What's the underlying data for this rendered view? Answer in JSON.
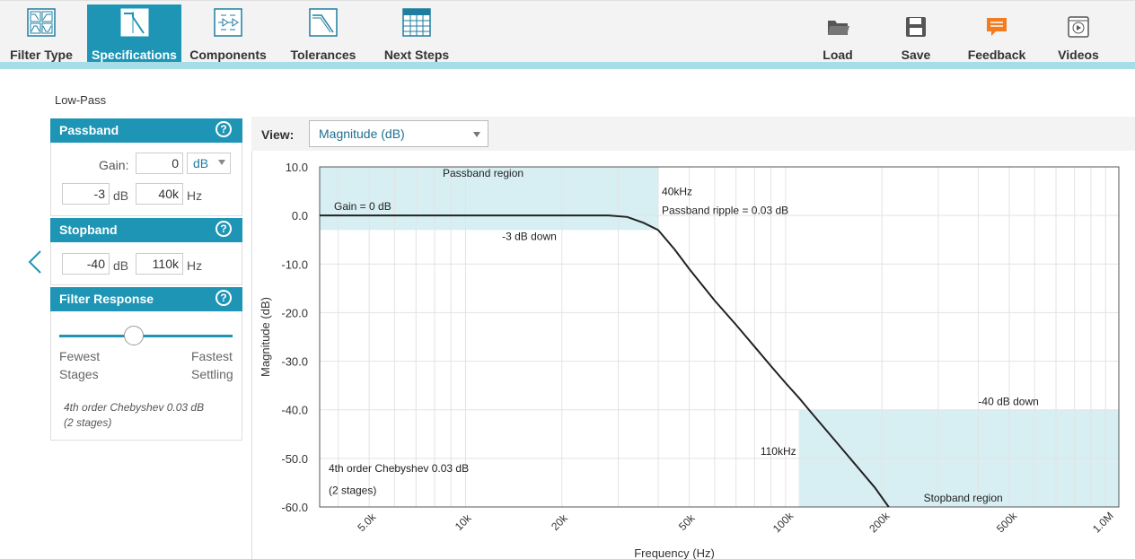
{
  "toolbar": {
    "tabs": [
      {
        "label": "Filter Type",
        "icon": "filter-type-icon"
      },
      {
        "label": "Specifications",
        "icon": "specifications-icon",
        "active": true
      },
      {
        "label": "Components",
        "icon": "components-icon"
      },
      {
        "label": "Tolerances",
        "icon": "tolerances-icon"
      },
      {
        "label": "Next Steps",
        "icon": "next-steps-icon"
      }
    ],
    "actions": [
      {
        "label": "Load",
        "icon": "folder-icon"
      },
      {
        "label": "Save",
        "icon": "floppy-disk-icon"
      },
      {
        "label": "Feedback",
        "icon": "chat-bubble-icon"
      },
      {
        "label": "Videos",
        "icon": "video-play-icon"
      }
    ],
    "accent_color": "#1f95b6",
    "feedback_color": "#f47c20"
  },
  "filter_type": "Low-Pass",
  "passband": {
    "title": "Passband",
    "gain_label": "Gain:",
    "gain_value": "0",
    "gain_unit": "dB",
    "atten_value": "-3",
    "atten_unit": "dB",
    "freq_value": "40k",
    "freq_unit": "Hz"
  },
  "stopband": {
    "title": "Stopband",
    "atten_value": "-40",
    "atten_unit": "dB",
    "freq_value": "110k",
    "freq_unit": "Hz"
  },
  "filter_response": {
    "title": "Filter Response",
    "slider_value_fraction": 0.43,
    "left_label_1": "Fewest",
    "left_label_2": "Stages",
    "right_label_1": "Fastest",
    "right_label_2": "Settling",
    "note_line1": "4th order Chebyshev 0.03 dB",
    "note_line2": "(2 stages)"
  },
  "view": {
    "label": "View:",
    "selected": "Magnitude (dB)"
  },
  "chart_data": {
    "type": "line",
    "x_scale": "log",
    "xlabel": "Frequency (Hz)",
    "ylabel": "Magnitude (dB)",
    "xlim": [
      3500,
      1100000
    ],
    "ylim": [
      -60,
      10
    ],
    "x_ticks": [
      5000,
      10000,
      20000,
      50000,
      100000,
      200000,
      500000,
      1000000
    ],
    "x_tick_labels": [
      "5.0k",
      "10k",
      "20k",
      "50k",
      "100k",
      "200k",
      "500k",
      "1.0M"
    ],
    "y_ticks": [
      10,
      0,
      -10,
      -20,
      -30,
      -40,
      -50,
      -60
    ],
    "y_tick_labels": [
      "10.0",
      "0.0",
      "-10.0",
      "-20.0",
      "-30.0",
      "-40.0",
      "-50.0",
      "-60.0"
    ],
    "grid": true,
    "series": [
      {
        "points": [
          [
            3500,
            0
          ],
          [
            10000,
            0
          ],
          [
            20000,
            0
          ],
          [
            28000,
            0
          ],
          [
            32000,
            -0.3
          ],
          [
            36000,
            -1.5
          ],
          [
            40000,
            -3
          ],
          [
            45000,
            -7
          ],
          [
            50000,
            -11
          ],
          [
            60000,
            -17.5
          ],
          [
            70000,
            -22.5
          ],
          [
            80000,
            -27
          ],
          [
            90000,
            -31
          ],
          [
            100000,
            -34.5
          ],
          [
            110000,
            -37.5
          ],
          [
            120000,
            -40.5
          ],
          [
            150000,
            -48
          ],
          [
            190000,
            -56
          ],
          [
            210000,
            -60
          ]
        ]
      }
    ],
    "regions": [
      {
        "label": "Passband region",
        "x": [
          3500,
          40000
        ],
        "y": [
          -3,
          10
        ]
      },
      {
        "label": "Stopband region",
        "x": [
          110000,
          1100000
        ],
        "y": [
          -60,
          -40
        ]
      }
    ],
    "annotations": {
      "gain": "Gain = 0 dB",
      "down3": "-3 dB down",
      "freq40": "40kHz",
      "ripple": "Passband ripple = 0.03 dB",
      "down40": "-40 dB down",
      "freq110": "110kHz",
      "order_line1": "4th order Chebyshev 0.03 dB",
      "order_line2": "(2 stages)"
    },
    "region_color": "#d7eff3",
    "line_color": "#222222"
  }
}
